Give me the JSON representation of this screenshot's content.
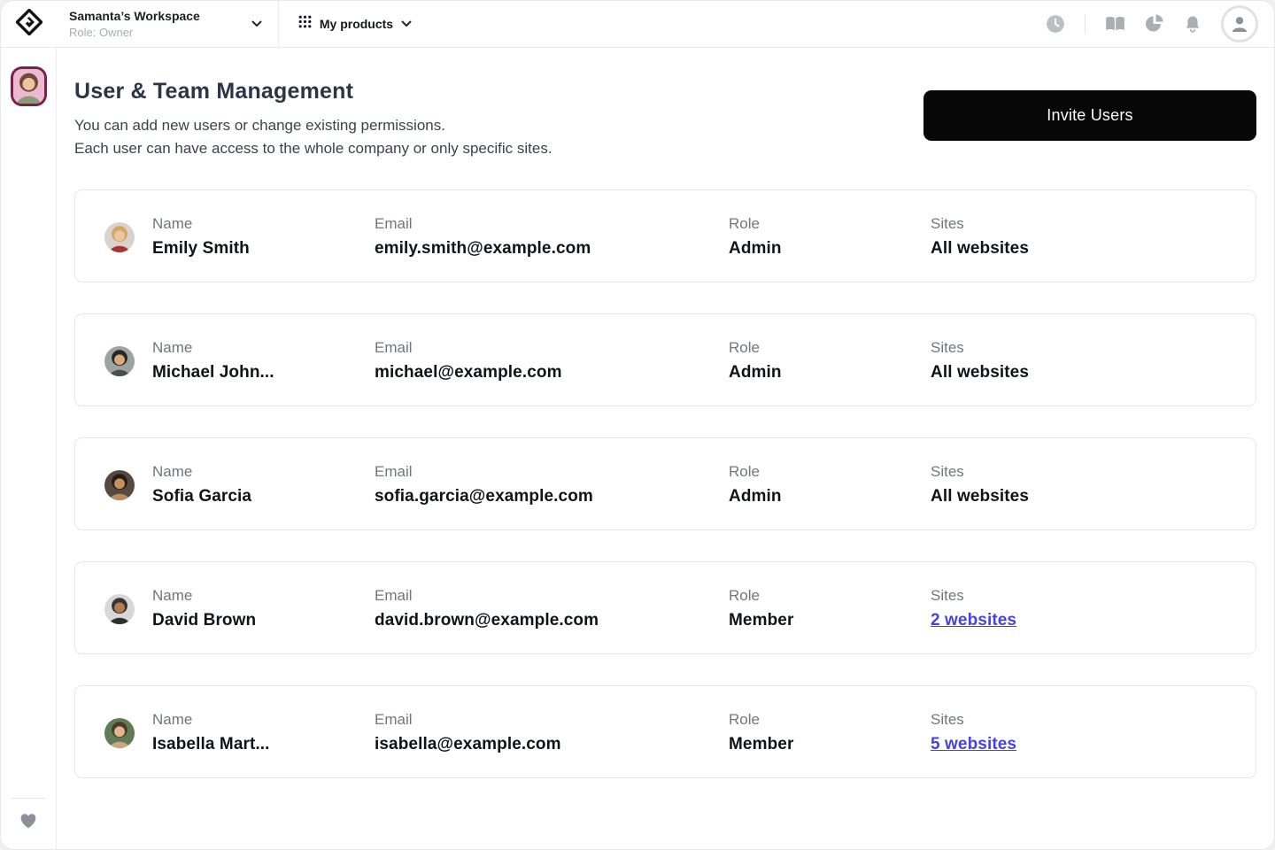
{
  "topbar": {
    "workspace_name": "Samanta’s Workspace",
    "workspace_role": "Role: Owner",
    "products_label": "My products",
    "icons": [
      "clock-icon",
      "docs-book-icon",
      "pie-chart-icon",
      "notifications-bell-icon",
      "account-avatar-icon"
    ]
  },
  "sidebar": {
    "items": [
      "workspace-avatar"
    ],
    "footer_icon": "heart-icon"
  },
  "main": {
    "title": "User & Team Management",
    "description_line1": "You can add new users or change existing permissions.",
    "description_line2": "Each user can have access to the whole company or only specific sites.",
    "invite_button": "Invite Users",
    "field_labels": {
      "name": "Name",
      "email": "Email",
      "role": "Role",
      "sites": "Sites"
    },
    "users": [
      {
        "name": "Emily Smith",
        "email": "emily.smith@example.com",
        "role": "Admin",
        "sites": "All websites",
        "sites_link": false,
        "avatar": {
          "bg": "#d9d3cc",
          "hair": "#d2a963",
          "skin": "#eec5a3",
          "shirt": "#a63434"
        }
      },
      {
        "name": "Michael John...",
        "email": "michael@example.com",
        "role": "Admin",
        "sites": "All websites",
        "sites_link": false,
        "avatar": {
          "bg": "#9ba4a1",
          "hair": "#262626",
          "skin": "#d9a979",
          "shirt": "#4a4f4c"
        }
      },
      {
        "name": "Sofia Garcia",
        "email": "sofia.garcia@example.com",
        "role": "Admin",
        "sites": "All websites",
        "sites_link": false,
        "avatar": {
          "bg": "#564a40",
          "hair": "#241d17",
          "skin": "#c78e5f",
          "shirt": "#b98c60"
        }
      },
      {
        "name": "David Brown",
        "email": "david.brown@example.com",
        "role": "Member",
        "sites": "2 websites",
        "sites_link": true,
        "avatar": {
          "bg": "#d8d8d6",
          "hair": "#343434",
          "skin": "#b57b4e",
          "shirt": "#2e2e2e"
        }
      },
      {
        "name": "Isabella Mart...",
        "email": "isabella@example.com",
        "role": "Member",
        "sites": "5 websites",
        "sites_link": true,
        "avatar": {
          "bg": "#5f7b58",
          "hair": "#4e3a29",
          "skin": "#e3b690",
          "shirt": "#caa87e"
        }
      }
    ]
  },
  "colors": {
    "link": "#4643e0",
    "invite_button_bg": "#070707",
    "sidebar_avatar_ring": "#76234a"
  }
}
